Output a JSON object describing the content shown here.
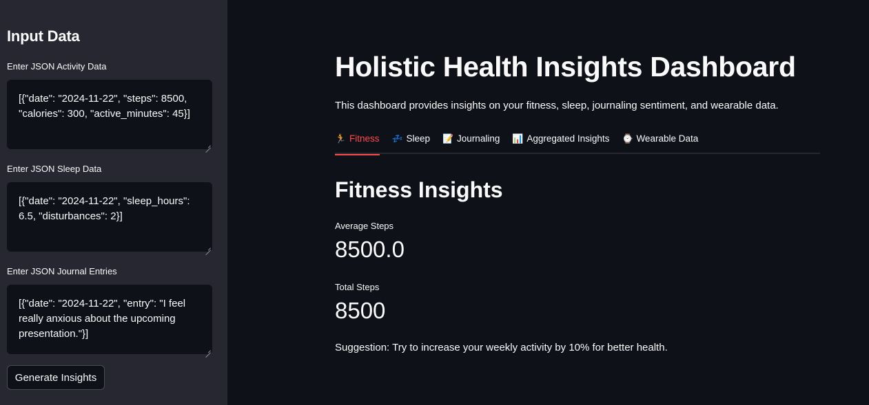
{
  "sidebar": {
    "title": "Input Data",
    "fields": [
      {
        "label": "Enter JSON Activity Data",
        "value": "[{\"date\": \"2024-11-22\", \"steps\": 8500, \"calories\": 300, \"active_minutes\": 45}]"
      },
      {
        "label": "Enter JSON Sleep Data",
        "value": "[{\"date\": \"2024-11-22\", \"sleep_hours\": 6.5, \"disturbances\": 2}]"
      },
      {
        "label": "Enter JSON Journal Entries",
        "value": "[{\"date\": \"2024-11-22\", \"entry\": \"I feel really anxious about the upcoming presentation.\"}]"
      }
    ],
    "button_label": "Generate Insights"
  },
  "main": {
    "title": "Holistic Health Insights Dashboard",
    "subtitle": "This dashboard provides insights on your fitness, sleep, journaling sentiment, and wearable data.",
    "tabs": [
      {
        "label": "Fitness",
        "icon": "running-person-icon",
        "glyph": "🏃",
        "active": true
      },
      {
        "label": "Sleep",
        "icon": "zzz-icon",
        "glyph": "💤",
        "active": false
      },
      {
        "label": "Journaling",
        "icon": "memo-icon",
        "glyph": "📝",
        "active": false
      },
      {
        "label": "Aggregated Insights",
        "icon": "bar-chart-icon",
        "glyph": "📊",
        "active": false
      },
      {
        "label": "Wearable Data",
        "icon": "watch-icon",
        "glyph": "⌚",
        "active": false
      }
    ],
    "section_title": "Fitness Insights",
    "metrics": [
      {
        "label": "Average Steps",
        "value": "8500.0"
      },
      {
        "label": "Total Steps",
        "value": "8500"
      }
    ],
    "suggestion": "Suggestion: Try to increase your weekly activity by 10% for better health."
  },
  "colors": {
    "background": "#0e1117",
    "sidebar": "#262730",
    "accent": "#ff4b4b",
    "text": "#fafafa"
  }
}
